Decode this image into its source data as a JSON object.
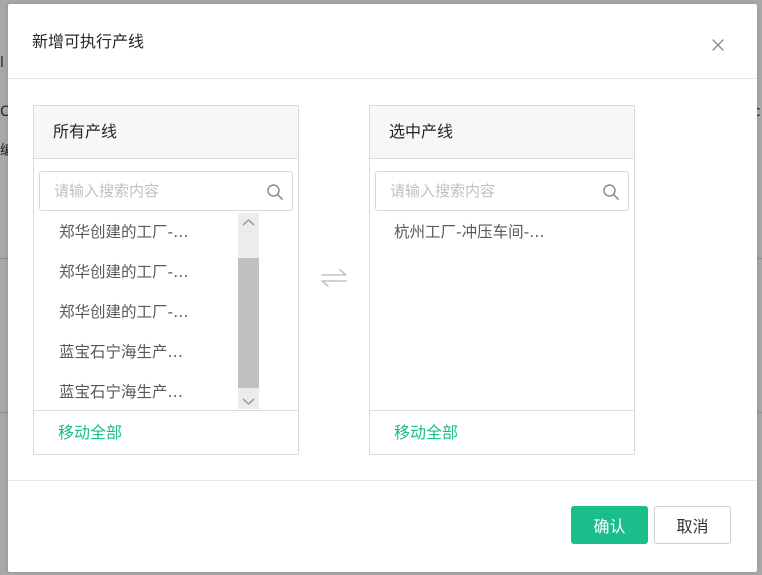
{
  "background": {
    "fragments": [
      "c",
      "l",
      "C",
      "-c",
      "编"
    ]
  },
  "dialog": {
    "title": "新增可执行产线",
    "close_label": "×"
  },
  "left_panel": {
    "title": "所有产线",
    "search_placeholder": "请输入搜索内容",
    "items": [
      "郑华创建的工厂-…",
      "郑华创建的工厂-…",
      "郑华创建的工厂-…",
      "蓝宝石宁海生产…",
      "蓝宝石宁海生产…"
    ],
    "move_all_label": "移动全部"
  },
  "right_panel": {
    "title": "选中产线",
    "search_placeholder": "请输入搜索内容",
    "items": [
      "杭州工厂-冲压车间-…"
    ],
    "move_all_label": "移动全部"
  },
  "footer": {
    "confirm_label": "确认",
    "cancel_label": "取消"
  },
  "colors": {
    "accent": "#19be8a",
    "overlay": "#a8a8a8",
    "panel_header_bg": "#f7f7f7"
  },
  "icons": {
    "close": "close-icon",
    "search": "search-icon",
    "transfer": "transfer-arrows-icon",
    "scroll_up": "chevron-up-icon",
    "scroll_down": "chevron-down-icon"
  }
}
